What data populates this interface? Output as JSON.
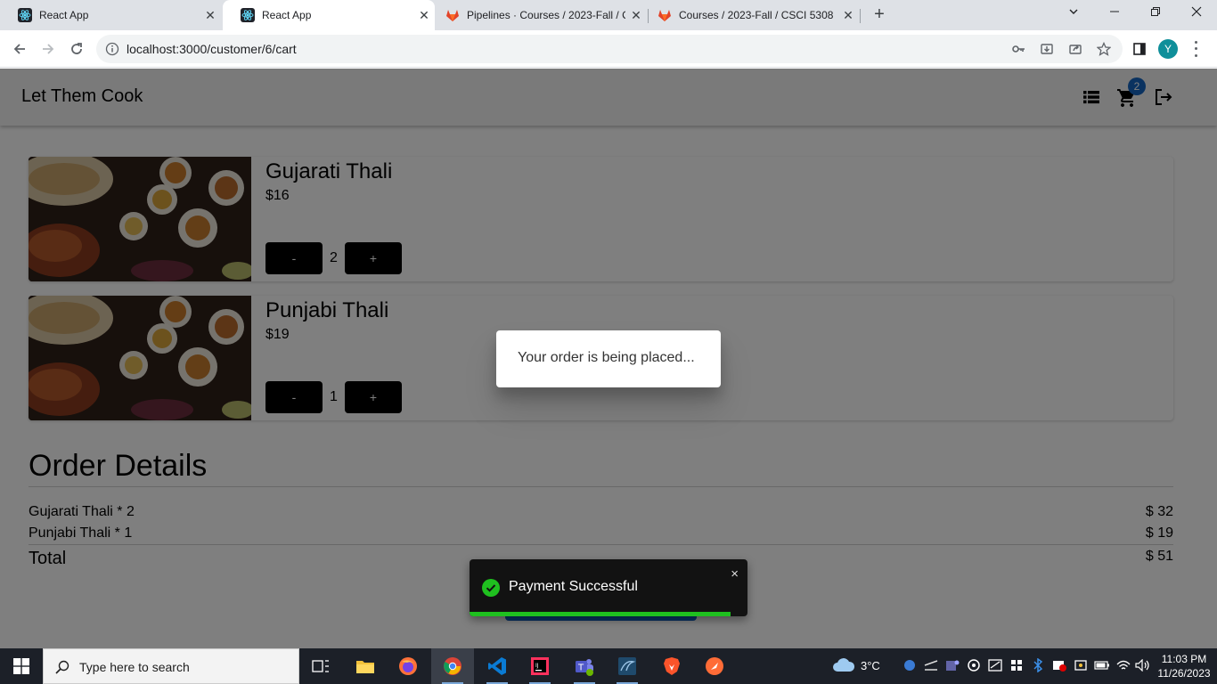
{
  "browser": {
    "tabs": [
      {
        "title": "React App",
        "active": false,
        "icon": "react-icon"
      },
      {
        "title": "React App",
        "active": true,
        "icon": "react-icon"
      },
      {
        "title": "Pipelines · Courses / 2023-Fall / C",
        "active": false,
        "icon": "gitlab-icon"
      },
      {
        "title": "Courses / 2023-Fall / CSCI 5308",
        "active": false,
        "icon": "gitlab-icon"
      }
    ],
    "url": "localhost:3000/customer/6/cart",
    "profile_initial": "Y"
  },
  "app": {
    "brand": "Let Them Cook",
    "cart_count": "2",
    "cart_items": [
      {
        "name": "Gujarati Thali",
        "price": "$16",
        "qty": "2",
        "minus": "-",
        "plus": "+"
      },
      {
        "name": "Punjabi Thali",
        "price": "$19",
        "qty": "1",
        "minus": "-",
        "plus": "+"
      }
    ],
    "order": {
      "title": "Order Details",
      "rows": [
        {
          "label": "Gujarati Thali * 2",
          "amount": "$ 32"
        },
        {
          "label": "Punjabi Thali * 1",
          "amount": "$ 19"
        }
      ],
      "total_label": "Total",
      "total_amount": "$ 51"
    },
    "dialog_text": "Your order is being placed...",
    "toast": {
      "message": "Payment Successful",
      "close": "×",
      "progress": 0.94
    }
  },
  "taskbar": {
    "search_placeholder": "Type here to search",
    "weather": "3°C",
    "time": "11:03 PM",
    "date": "11/26/2023"
  },
  "colors": {
    "toast_bg": "#121212",
    "toast_progress": "#1fc01f",
    "overlay": "rgba(0,0,0,0.5)",
    "cart_badge": "#1565c0"
  }
}
